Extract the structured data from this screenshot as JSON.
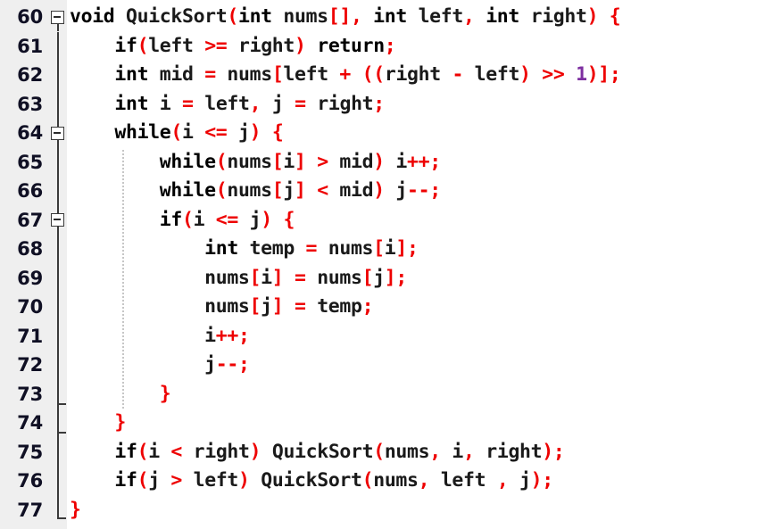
{
  "editor": {
    "language": "c-like",
    "first_line": 60,
    "last_line": 77,
    "colors": {
      "gutter_background": "#efefef",
      "code_background": "#ffffff",
      "line_number": "#101024",
      "keyword": "#000000",
      "identifier": "#1a1a1a",
      "operator": "#ee0000",
      "number_literal": "#7d2fa0",
      "fold_marker": "#3a3a3a",
      "indent_guide": "#c6c6c6"
    }
  },
  "lines": [
    {
      "number": "60",
      "fold": "box-open-top",
      "tokens": [
        {
          "t": "void",
          "c": "kw"
        },
        {
          "t": " ",
          "c": "pl"
        },
        {
          "t": "QuickSort",
          "c": "id"
        },
        {
          "t": "(",
          "c": "op"
        },
        {
          "t": "int",
          "c": "kw"
        },
        {
          "t": " ",
          "c": "pl"
        },
        {
          "t": "nums",
          "c": "id"
        },
        {
          "t": "[],",
          "c": "op"
        },
        {
          "t": " ",
          "c": "pl"
        },
        {
          "t": "int",
          "c": "kw"
        },
        {
          "t": " ",
          "c": "pl"
        },
        {
          "t": "left",
          "c": "id"
        },
        {
          "t": ",",
          "c": "op"
        },
        {
          "t": " ",
          "c": "pl"
        },
        {
          "t": "int",
          "c": "kw"
        },
        {
          "t": " ",
          "c": "pl"
        },
        {
          "t": "right",
          "c": "id"
        },
        {
          "t": ")",
          "c": "op"
        },
        {
          "t": " ",
          "c": "pl"
        },
        {
          "t": "{",
          "c": "op"
        }
      ]
    },
    {
      "number": "61",
      "fold": "line",
      "tokens": [
        {
          "t": "    ",
          "c": "pl"
        },
        {
          "t": "if",
          "c": "kw"
        },
        {
          "t": "(",
          "c": "op"
        },
        {
          "t": "left",
          "c": "id"
        },
        {
          "t": " ",
          "c": "pl"
        },
        {
          "t": ">=",
          "c": "op"
        },
        {
          "t": " ",
          "c": "pl"
        },
        {
          "t": "right",
          "c": "id"
        },
        {
          "t": ")",
          "c": "op"
        },
        {
          "t": " ",
          "c": "pl"
        },
        {
          "t": "return",
          "c": "kw"
        },
        {
          "t": ";",
          "c": "op"
        }
      ]
    },
    {
      "number": "62",
      "fold": "line",
      "tokens": [
        {
          "t": "    ",
          "c": "pl"
        },
        {
          "t": "int",
          "c": "kw"
        },
        {
          "t": " ",
          "c": "pl"
        },
        {
          "t": "mid",
          "c": "id"
        },
        {
          "t": " ",
          "c": "pl"
        },
        {
          "t": "=",
          "c": "op"
        },
        {
          "t": " ",
          "c": "pl"
        },
        {
          "t": "nums",
          "c": "id"
        },
        {
          "t": "[",
          "c": "op"
        },
        {
          "t": "left",
          "c": "id"
        },
        {
          "t": " ",
          "c": "pl"
        },
        {
          "t": "+",
          "c": "op"
        },
        {
          "t": " ",
          "c": "pl"
        },
        {
          "t": "((",
          "c": "op"
        },
        {
          "t": "right",
          "c": "id"
        },
        {
          "t": " ",
          "c": "pl"
        },
        {
          "t": "-",
          "c": "op"
        },
        {
          "t": " ",
          "c": "pl"
        },
        {
          "t": "left",
          "c": "id"
        },
        {
          "t": ")",
          "c": "op"
        },
        {
          "t": " ",
          "c": "pl"
        },
        {
          "t": ">>",
          "c": "op"
        },
        {
          "t": " ",
          "c": "pl"
        },
        {
          "t": "1",
          "c": "num"
        },
        {
          "t": ")];",
          "c": "op"
        }
      ]
    },
    {
      "number": "63",
      "fold": "line",
      "tokens": [
        {
          "t": "    ",
          "c": "pl"
        },
        {
          "t": "int",
          "c": "kw"
        },
        {
          "t": " ",
          "c": "pl"
        },
        {
          "t": "i",
          "c": "id"
        },
        {
          "t": " ",
          "c": "pl"
        },
        {
          "t": "=",
          "c": "op"
        },
        {
          "t": " ",
          "c": "pl"
        },
        {
          "t": "left",
          "c": "id"
        },
        {
          "t": ",",
          "c": "op"
        },
        {
          "t": " ",
          "c": "pl"
        },
        {
          "t": "j",
          "c": "id"
        },
        {
          "t": " ",
          "c": "pl"
        },
        {
          "t": "=",
          "c": "op"
        },
        {
          "t": " ",
          "c": "pl"
        },
        {
          "t": "right",
          "c": "id"
        },
        {
          "t": ";",
          "c": "op"
        }
      ]
    },
    {
      "number": "64",
      "fold": "box-mid",
      "tokens": [
        {
          "t": "    ",
          "c": "pl"
        },
        {
          "t": "while",
          "c": "kw"
        },
        {
          "t": "(",
          "c": "op"
        },
        {
          "t": "i",
          "c": "id"
        },
        {
          "t": " ",
          "c": "pl"
        },
        {
          "t": "<=",
          "c": "op"
        },
        {
          "t": " ",
          "c": "pl"
        },
        {
          "t": "j",
          "c": "id"
        },
        {
          "t": ")",
          "c": "op"
        },
        {
          "t": " ",
          "c": "pl"
        },
        {
          "t": "{",
          "c": "op"
        }
      ]
    },
    {
      "number": "65",
      "fold": "line",
      "tokens": [
        {
          "t": "        ",
          "c": "pl"
        },
        {
          "t": "while",
          "c": "kw"
        },
        {
          "t": "(",
          "c": "op"
        },
        {
          "t": "nums",
          "c": "id"
        },
        {
          "t": "[",
          "c": "op"
        },
        {
          "t": "i",
          "c": "id"
        },
        {
          "t": "]",
          "c": "op"
        },
        {
          "t": " ",
          "c": "pl"
        },
        {
          "t": ">",
          "c": "op"
        },
        {
          "t": " ",
          "c": "pl"
        },
        {
          "t": "mid",
          "c": "id"
        },
        {
          "t": ")",
          "c": "op"
        },
        {
          "t": " ",
          "c": "pl"
        },
        {
          "t": "i",
          "c": "id"
        },
        {
          "t": "++;",
          "c": "op"
        }
      ]
    },
    {
      "number": "66",
      "fold": "line",
      "tokens": [
        {
          "t": "        ",
          "c": "pl"
        },
        {
          "t": "while",
          "c": "kw"
        },
        {
          "t": "(",
          "c": "op"
        },
        {
          "t": "nums",
          "c": "id"
        },
        {
          "t": "[",
          "c": "op"
        },
        {
          "t": "j",
          "c": "id"
        },
        {
          "t": "]",
          "c": "op"
        },
        {
          "t": " ",
          "c": "pl"
        },
        {
          "t": "<",
          "c": "op"
        },
        {
          "t": " ",
          "c": "pl"
        },
        {
          "t": "mid",
          "c": "id"
        },
        {
          "t": ")",
          "c": "op"
        },
        {
          "t": " ",
          "c": "pl"
        },
        {
          "t": "j",
          "c": "id"
        },
        {
          "t": "--;",
          "c": "op"
        }
      ]
    },
    {
      "number": "67",
      "fold": "box-mid",
      "tokens": [
        {
          "t": "        ",
          "c": "pl"
        },
        {
          "t": "if",
          "c": "kw"
        },
        {
          "t": "(",
          "c": "op"
        },
        {
          "t": "i",
          "c": "id"
        },
        {
          "t": " ",
          "c": "pl"
        },
        {
          "t": "<=",
          "c": "op"
        },
        {
          "t": " ",
          "c": "pl"
        },
        {
          "t": "j",
          "c": "id"
        },
        {
          "t": ")",
          "c": "op"
        },
        {
          "t": " ",
          "c": "pl"
        },
        {
          "t": "{",
          "c": "op"
        }
      ]
    },
    {
      "number": "68",
      "fold": "line",
      "tokens": [
        {
          "t": "            ",
          "c": "pl"
        },
        {
          "t": "int",
          "c": "kw"
        },
        {
          "t": " ",
          "c": "pl"
        },
        {
          "t": "temp",
          "c": "id"
        },
        {
          "t": " ",
          "c": "pl"
        },
        {
          "t": "=",
          "c": "op"
        },
        {
          "t": " ",
          "c": "pl"
        },
        {
          "t": "nums",
          "c": "id"
        },
        {
          "t": "[",
          "c": "op"
        },
        {
          "t": "i",
          "c": "id"
        },
        {
          "t": "];",
          "c": "op"
        }
      ]
    },
    {
      "number": "69",
      "fold": "line",
      "tokens": [
        {
          "t": "            ",
          "c": "pl"
        },
        {
          "t": "nums",
          "c": "id"
        },
        {
          "t": "[",
          "c": "op"
        },
        {
          "t": "i",
          "c": "id"
        },
        {
          "t": "]",
          "c": "op"
        },
        {
          "t": " ",
          "c": "pl"
        },
        {
          "t": "=",
          "c": "op"
        },
        {
          "t": " ",
          "c": "pl"
        },
        {
          "t": "nums",
          "c": "id"
        },
        {
          "t": "[",
          "c": "op"
        },
        {
          "t": "j",
          "c": "id"
        },
        {
          "t": "];",
          "c": "op"
        }
      ]
    },
    {
      "number": "70",
      "fold": "line",
      "tokens": [
        {
          "t": "            ",
          "c": "pl"
        },
        {
          "t": "nums",
          "c": "id"
        },
        {
          "t": "[",
          "c": "op"
        },
        {
          "t": "j",
          "c": "id"
        },
        {
          "t": "]",
          "c": "op"
        },
        {
          "t": " ",
          "c": "pl"
        },
        {
          "t": "=",
          "c": "op"
        },
        {
          "t": " ",
          "c": "pl"
        },
        {
          "t": "temp",
          "c": "id"
        },
        {
          "t": ";",
          "c": "op"
        }
      ]
    },
    {
      "number": "71",
      "fold": "line",
      "tokens": [
        {
          "t": "            ",
          "c": "pl"
        },
        {
          "t": "i",
          "c": "id"
        },
        {
          "t": "++;",
          "c": "op"
        }
      ]
    },
    {
      "number": "72",
      "fold": "line",
      "tokens": [
        {
          "t": "            ",
          "c": "pl"
        },
        {
          "t": "j",
          "c": "id"
        },
        {
          "t": "--;",
          "c": "op"
        }
      ]
    },
    {
      "number": "73",
      "fold": "tick",
      "tokens": [
        {
          "t": "        ",
          "c": "pl"
        },
        {
          "t": "}",
          "c": "op"
        }
      ]
    },
    {
      "number": "74",
      "fold": "tick",
      "tokens": [
        {
          "t": "    ",
          "c": "pl"
        },
        {
          "t": "}",
          "c": "op"
        }
      ]
    },
    {
      "number": "75",
      "fold": "line",
      "tokens": [
        {
          "t": "    ",
          "c": "pl"
        },
        {
          "t": "if",
          "c": "kw"
        },
        {
          "t": "(",
          "c": "op"
        },
        {
          "t": "i",
          "c": "id"
        },
        {
          "t": " ",
          "c": "pl"
        },
        {
          "t": "<",
          "c": "op"
        },
        {
          "t": " ",
          "c": "pl"
        },
        {
          "t": "right",
          "c": "id"
        },
        {
          "t": ")",
          "c": "op"
        },
        {
          "t": " ",
          "c": "pl"
        },
        {
          "t": "QuickSort",
          "c": "id"
        },
        {
          "t": "(",
          "c": "op"
        },
        {
          "t": "nums",
          "c": "id"
        },
        {
          "t": ",",
          "c": "op"
        },
        {
          "t": " ",
          "c": "pl"
        },
        {
          "t": "i",
          "c": "id"
        },
        {
          "t": ",",
          "c": "op"
        },
        {
          "t": " ",
          "c": "pl"
        },
        {
          "t": "right",
          "c": "id"
        },
        {
          "t": ");",
          "c": "op"
        }
      ]
    },
    {
      "number": "76",
      "fold": "line",
      "tokens": [
        {
          "t": "    ",
          "c": "pl"
        },
        {
          "t": "if",
          "c": "kw"
        },
        {
          "t": "(",
          "c": "op"
        },
        {
          "t": "j",
          "c": "id"
        },
        {
          "t": " ",
          "c": "pl"
        },
        {
          "t": ">",
          "c": "op"
        },
        {
          "t": " ",
          "c": "pl"
        },
        {
          "t": "left",
          "c": "id"
        },
        {
          "t": ")",
          "c": "op"
        },
        {
          "t": " ",
          "c": "pl"
        },
        {
          "t": "QuickSort",
          "c": "id"
        },
        {
          "t": "(",
          "c": "op"
        },
        {
          "t": "nums",
          "c": "id"
        },
        {
          "t": ",",
          "c": "op"
        },
        {
          "t": " ",
          "c": "pl"
        },
        {
          "t": "left",
          "c": "id"
        },
        {
          "t": " ",
          "c": "pl"
        },
        {
          "t": ",",
          "c": "op"
        },
        {
          "t": " ",
          "c": "pl"
        },
        {
          "t": "j",
          "c": "id"
        },
        {
          "t": ");",
          "c": "op"
        }
      ]
    },
    {
      "number": "77",
      "fold": "corner",
      "tokens": [
        {
          "t": "}",
          "c": "op"
        }
      ]
    }
  ]
}
